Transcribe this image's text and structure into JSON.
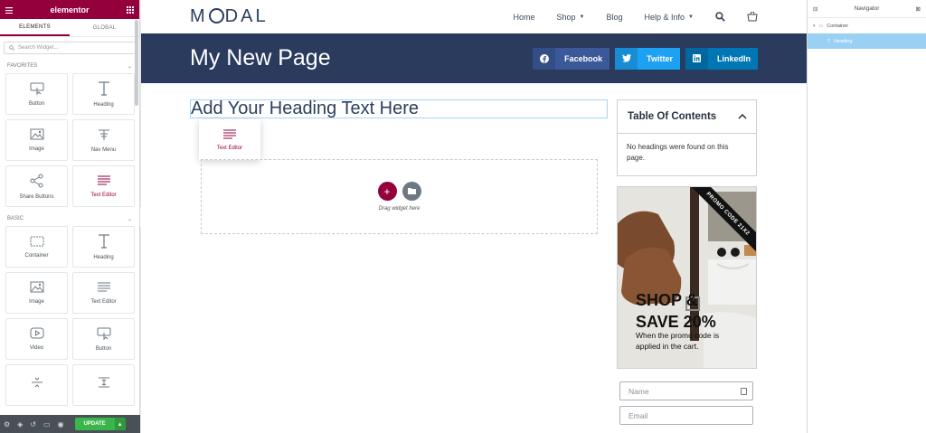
{
  "panel": {
    "logo": "elementor",
    "tabs": [
      "ELEMENTS",
      "GLOBAL"
    ],
    "search_placeholder": "Search Widget...",
    "favorites_label": "FAVORITES",
    "basic_label": "BASIC",
    "favorites": [
      "Button",
      "Heading",
      "Image",
      "Nav Menu",
      "Share Buttons",
      "Text Editor"
    ],
    "basic": [
      "Container",
      "Heading",
      "Image",
      "Text Editor",
      "Video",
      "Button"
    ],
    "update_label": "UPDATE"
  },
  "site": {
    "logo_left": "M",
    "logo_right": "DAL",
    "nav": [
      "Home",
      "Shop",
      "Blog",
      "Help & Info"
    ],
    "page_title": "My New Page",
    "share": [
      "Facebook",
      "Twitter",
      "LinkedIn"
    ]
  },
  "canvas": {
    "heading": "Add Your Heading Text Here",
    "drag_tip": "Text Editor",
    "drop_text": "Drag widget here"
  },
  "toc": {
    "title": "Table Of Contents",
    "body": "No headings were found on this page."
  },
  "promo": {
    "ribbon": "PROMO CODE 21X2",
    "headline_1": "SHOP &",
    "headline_2": "SAVE 20%",
    "sub_1": "When the promo code is",
    "sub_2": "applied in the cart."
  },
  "form": {
    "name_placeholder": "Name",
    "email_placeholder": "Email"
  },
  "navigator": {
    "title": "Navigator",
    "container": "Container",
    "heading": "Heading"
  },
  "colors": {
    "brand": "#93003c",
    "title_bar": "#2a3b5e",
    "update": "#39b54a",
    "nav_selected": "#99d1f4"
  }
}
